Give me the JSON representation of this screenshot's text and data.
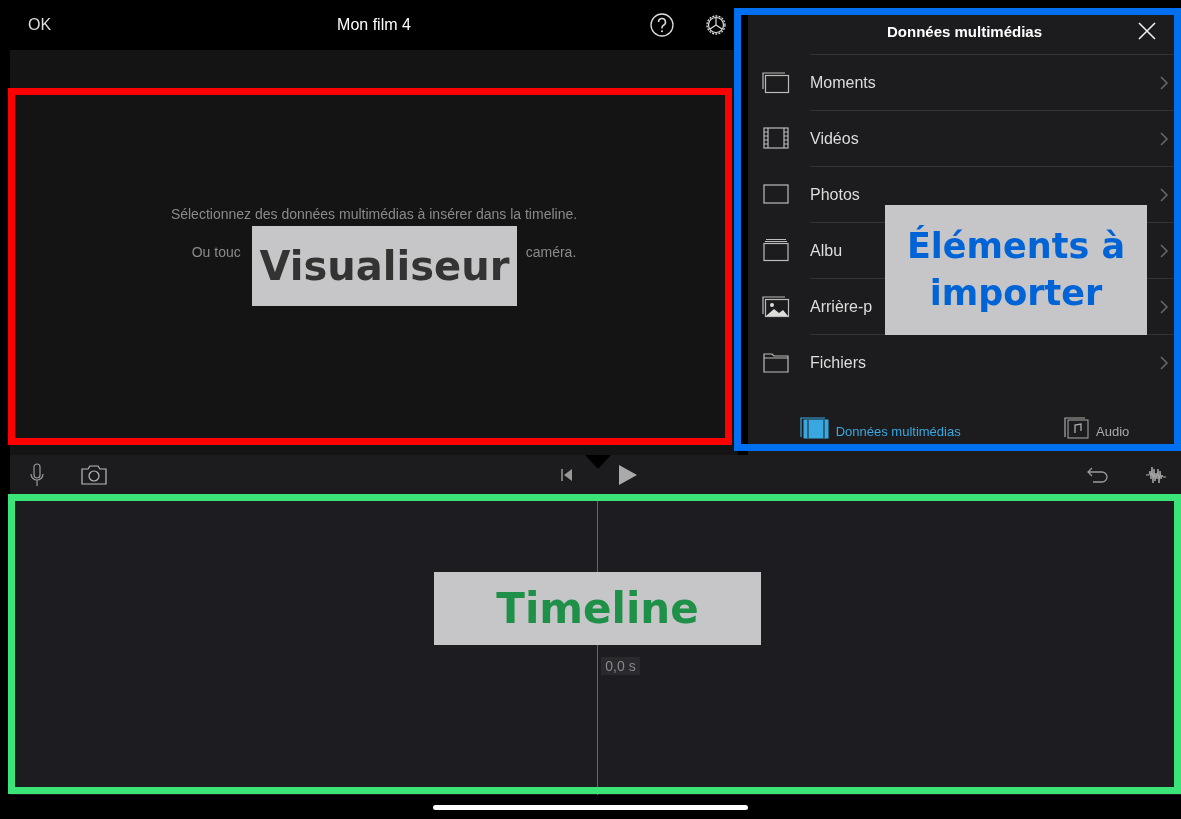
{
  "top_bar": {
    "done": "OK",
    "title": "Mon film 4"
  },
  "viewer": {
    "message": "Sélectionnez des données multimédias à insérer dans la timeline.",
    "hint_parts": [
      "Ou touc",
      "caméra."
    ]
  },
  "media_panel": {
    "title": "Données multimédias",
    "items": [
      {
        "kind": "moments",
        "label": "Moments"
      },
      {
        "kind": "videos",
        "label": "Vidéos"
      },
      {
        "kind": "photos",
        "label": "Photos"
      },
      {
        "kind": "albums",
        "label": "Albu"
      },
      {
        "kind": "backgrounds",
        "label": "Arrière-p"
      },
      {
        "kind": "files",
        "label": "Fichiers"
      }
    ],
    "tabs": [
      {
        "kind": "media",
        "label": "Données multimédias",
        "selected": true
      },
      {
        "kind": "audio",
        "label": "Audio",
        "selected": false
      }
    ]
  },
  "timeline": {
    "time": "0,0 s"
  },
  "annotations": [
    {
      "kind": "viewer",
      "label": "Visualiseur",
      "color": "#ff0000"
    },
    {
      "kind": "media",
      "label": "Éléments à importer",
      "color": "#0070f0"
    },
    {
      "kind": "timeline",
      "label": "Timeline",
      "color": "#3be477"
    }
  ]
}
